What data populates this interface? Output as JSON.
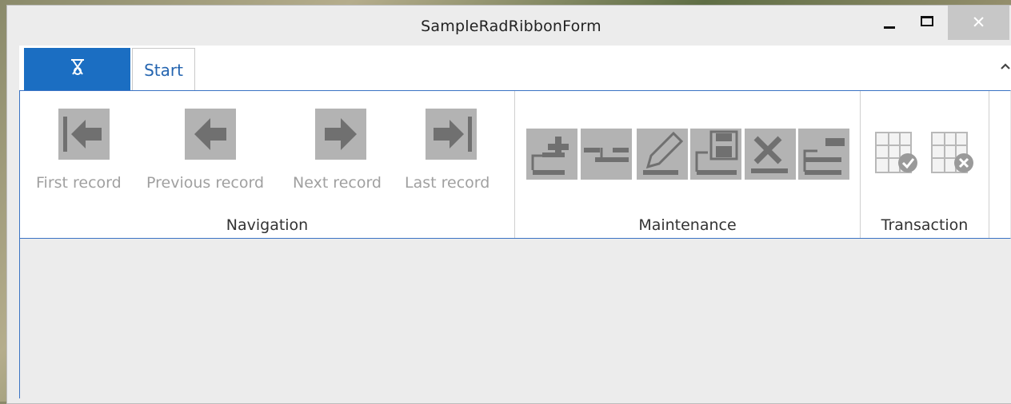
{
  "window": {
    "title": "SampleRadRibbonForm"
  },
  "ribbon": {
    "tabs": [
      {
        "label": "Start"
      }
    ],
    "groups": {
      "navigation": {
        "label": "Navigation",
        "buttons": [
          {
            "label": "First record",
            "icon": "first-record-icon"
          },
          {
            "label": "Previous record",
            "icon": "previous-record-icon"
          },
          {
            "label": "Next record",
            "icon": "next-record-icon"
          },
          {
            "label": "Last record",
            "icon": "last-record-icon"
          }
        ]
      },
      "maintenance": {
        "label": "Maintenance",
        "buttons": [
          {
            "icon": "add-row-icon"
          },
          {
            "icon": "insert-row-icon"
          },
          {
            "icon": "edit-row-icon"
          },
          {
            "icon": "save-row-icon"
          },
          {
            "icon": "delete-row-icon"
          },
          {
            "icon": "remove-row-icon"
          }
        ]
      },
      "transaction": {
        "label": "Transaction",
        "buttons": [
          {
            "icon": "commit-icon"
          },
          {
            "icon": "rollback-icon"
          }
        ]
      }
    }
  },
  "colors": {
    "accent": "#1b6ec2",
    "tab_text": "#2565b0",
    "disabled_text": "#a0a0a0",
    "icon_gray": "#b3b3b3"
  }
}
